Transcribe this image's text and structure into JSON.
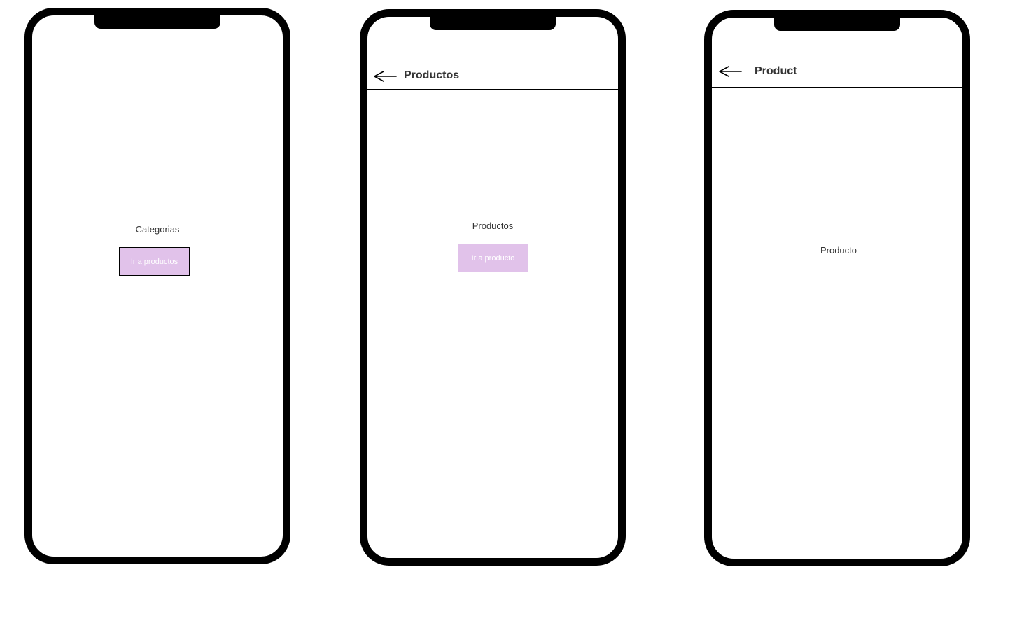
{
  "colors": {
    "button_fill": "#e1c2ea",
    "button_text": "#ffffff",
    "frame": "#000000",
    "text": "#333333"
  },
  "screens": [
    {
      "label": "Categorias",
      "button_label": "Ir a productos"
    },
    {
      "header": {
        "back_icon": "arrow-left-icon",
        "title": "Productos"
      },
      "label": "Productos",
      "button_label": "Ir a producto"
    },
    {
      "header": {
        "back_icon": "arrow-left-icon",
        "title": "Product"
      },
      "label": "Producto"
    }
  ]
}
